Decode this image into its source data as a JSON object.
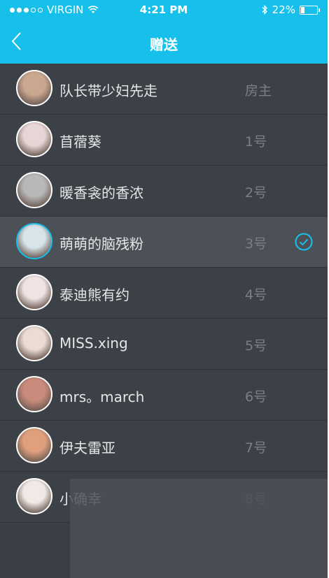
{
  "status_bar": {
    "carrier": "VIRGIN",
    "time": "4:21 PM",
    "battery": "22%",
    "battery_fraction": 0.22
  },
  "header": {
    "title": "赠送"
  },
  "members": [
    {
      "name": "队长带少妇先走",
      "seat": "房主",
      "selected": false,
      "avatar_color": "#caa890"
    },
    {
      "name": "苜蓿葵",
      "seat": "1号",
      "selected": false,
      "avatar_color": "#e8d5d5"
    },
    {
      "name": "暖香衾的香浓",
      "seat": "2号",
      "selected": false,
      "avatar_color": "#b8b8b8"
    },
    {
      "name": "萌萌的脑残粉",
      "seat": "3号",
      "selected": true,
      "avatar_color": "#d7e4ea"
    },
    {
      "name": "泰迪熊有约",
      "seat": "4号",
      "selected": false,
      "avatar_color": "#f0e3e3"
    },
    {
      "name": "MISS.xing",
      "seat": "5号",
      "selected": false,
      "avatar_color": "#eadcd5"
    },
    {
      "name": "mrs。march",
      "seat": "6号",
      "selected": false,
      "avatar_color": "#c98b7b"
    },
    {
      "name": "伊夫雷亚",
      "seat": "7号",
      "selected": false,
      "avatar_color": "#e0a07e"
    },
    {
      "name": "小确幸",
      "seat": "8号",
      "selected": false,
      "avatar_color": "#f0e9e6"
    }
  ],
  "colors": {
    "accent": "#16c0ea",
    "list_bg": "#3c4148",
    "selected_bg": "#4c5158",
    "seat_text": "#7a7f86"
  }
}
